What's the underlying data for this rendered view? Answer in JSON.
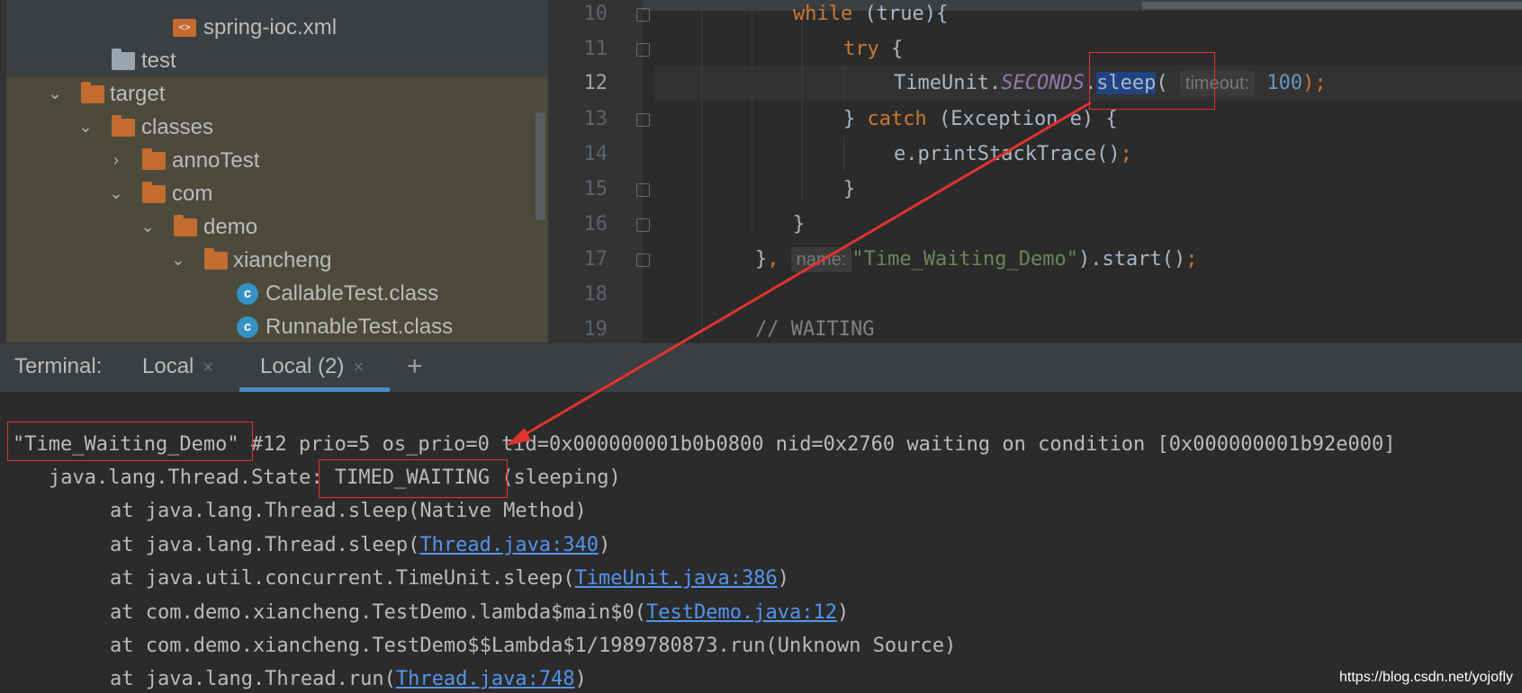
{
  "tree": {
    "items": [
      {
        "label": "spring-ioc.xml"
      },
      {
        "label": "test"
      },
      {
        "label": "target"
      },
      {
        "label": "classes"
      },
      {
        "label": "annoTest"
      },
      {
        "label": "com"
      },
      {
        "label": "demo"
      },
      {
        "label": "xiancheng"
      },
      {
        "label": "CallableTest.class"
      },
      {
        "label": "RunnableTest.class"
      }
    ],
    "class_icon_letter": "c",
    "xml_icon_text": "<>"
  },
  "editor": {
    "line_numbers": [
      "10",
      "11",
      "12",
      "13",
      "14",
      "15",
      "16",
      "17",
      "18",
      "19"
    ],
    "current_line": "12",
    "code": {
      "l10_kw": "while",
      "l10_rest": " (true){",
      "l11_kw": "try",
      "l11_rest": " {",
      "l12_a": "TimeUnit.",
      "l12_b": "SECONDS",
      "l12_c": ".",
      "l12_d": "sleep",
      "l12_e": "(",
      "l12_hint": "timeout:",
      "l12_num": "100",
      "l12_f": ");",
      "l13_a": "} ",
      "l13_kw": "catch",
      "l13_rest": " (Exception e) {",
      "l14_a": "e.printStackTrace()",
      "l14_b": ";",
      "l15": "}",
      "l16": "}",
      "l17_a": "}",
      "l17_b": ",",
      "l17_hint": "name:",
      "l17_str": "\"Time_Waiting_Demo\"",
      "l17_c": ").start()",
      "l17_d": ";",
      "l19": "// WAITING"
    }
  },
  "terminal": {
    "title": "Terminal:",
    "tabs": [
      {
        "label": "Local"
      },
      {
        "label": "Local (2)"
      }
    ],
    "close_glyph": "×",
    "add_glyph": "+",
    "lines": {
      "l1_name": "\"Time_Waiting_Demo\"",
      "l1_rest": " #12 prio=5 os_prio=0 tid=0x000000001b0b0800 nid=0x2760 waiting on condition [0x000000001b92e000]",
      "l2_a": "java.lang.Thread.State",
      "l2_b": ": TIMED_WAITING",
      "l2_c": " (sleeping)",
      "l3": "at java.lang.Thread.sleep(Native Method)",
      "l4_a": "at java.lang.Thread.sleep(",
      "l4_link": "Thread.java:340",
      "l4_b": ")",
      "l5_a": "at java.util.concurrent.TimeUnit.sleep(",
      "l5_link": "TimeUnit.java:386",
      "l5_b": ")",
      "l6_a": "at com.demo.xiancheng.TestDemo.lambda$main$0(",
      "l6_link": "TestDemo.java:12",
      "l6_b": ")",
      "l7": "at com.demo.xiancheng.TestDemo$$Lambda$1/1989780873.run(Unknown Source)",
      "l8_a": "at java.lang.Thread.run(",
      "l8_link": "Thread.java:748",
      "l8_b": ")"
    }
  },
  "watermark": "https://blog.csdn.net/yojofly",
  "colors": {
    "annotation": "#e0332f",
    "tab_underline": "#4a88c7",
    "link": "#5394ec"
  }
}
